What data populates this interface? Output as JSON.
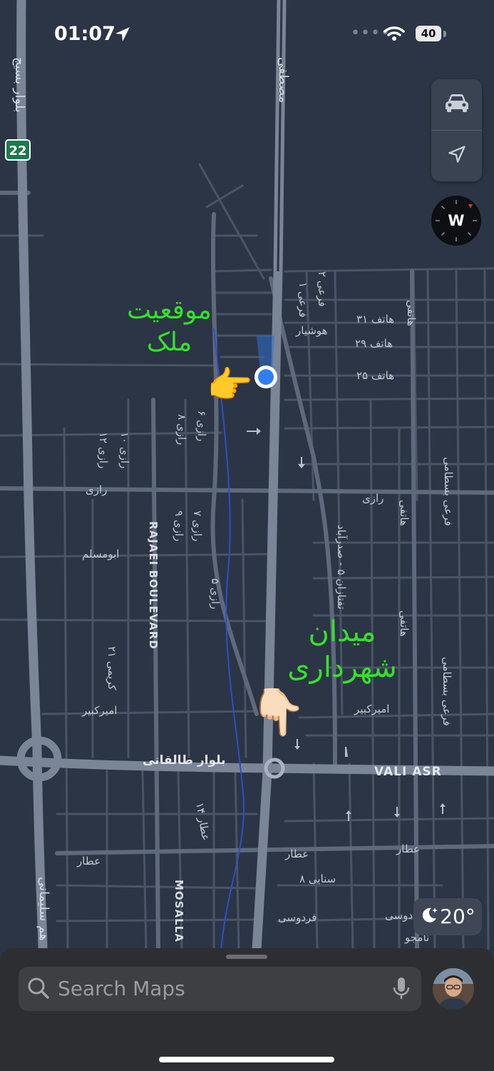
{
  "status_bar": {
    "time": "01:07",
    "battery": "40"
  },
  "map": {
    "highway_shield": "22",
    "roads": {
      "basij": "بلوار بسیج",
      "mostafa": "مصطفی",
      "hoshyar": "هوشیار",
      "far1": "فرعی ۱",
      "far2": "فرعی ۲",
      "hatef31": "هاتف ۳۱",
      "hatef29": "هاتف ۲۹",
      "hatef25": "هاتف ۲۵",
      "hatefi1": "هاتفی",
      "hatefi2": "هاتفی",
      "hatefi3": "هاتفی",
      "razi6": "رازی ۶",
      "razi8": "رازی ۸",
      "razi10": "رازی ۱۰",
      "razi12": "رازی ۱۲",
      "razi7": "رازی ۷",
      "razi9": "رازی ۹",
      "razi5": "رازی ۵",
      "razi_w": "رازی",
      "razi_e": "رازی",
      "rajaei": "RAJAEI BOULEVARD",
      "abumoslem": "ابومسلم",
      "karimi21": "کریمی ۲۱",
      "amirkabir_w": "امیرکبیر",
      "amirkabir_e": "امیرکبیر",
      "saffarzadeh": "تفتازان ۵ - صدرآباد",
      "bastami1": "فرعی بسطامی",
      "bastami2": "فرعی بسطامی",
      "taleghani": "بلوار طالقانی",
      "valiasr": "VALI ASR",
      "attar14": "عطار ۱۴",
      "attar_w": "عطار",
      "attar_m": "عطار",
      "attar_e": "عطار",
      "sanaei8": "سنایی ۸",
      "ferdowsi_w": "فردوسی",
      "ferdowsi_e": "دوسی",
      "namjoo": "نامجو",
      "mosalla": "MOSALLA",
      "soleimani": "هم سلیمانی"
    }
  },
  "controls": {
    "compass_letter": "W"
  },
  "annotations": {
    "property_line1": "موقعیت",
    "property_line2": "ملک",
    "square_line1": "میدان",
    "square_line2": "شهرداری",
    "pointer_right": "👉",
    "pointer_down": "👇🏻"
  },
  "weather": {
    "temp": "20°"
  },
  "search": {
    "placeholder": "Search Maps"
  },
  "icons": {
    "car": "car-icon",
    "location": "location-arrow-icon",
    "compass": "compass-icon",
    "search": "magnifier-icon",
    "mic": "microphone-icon",
    "moon": "moon-stars-icon"
  }
}
